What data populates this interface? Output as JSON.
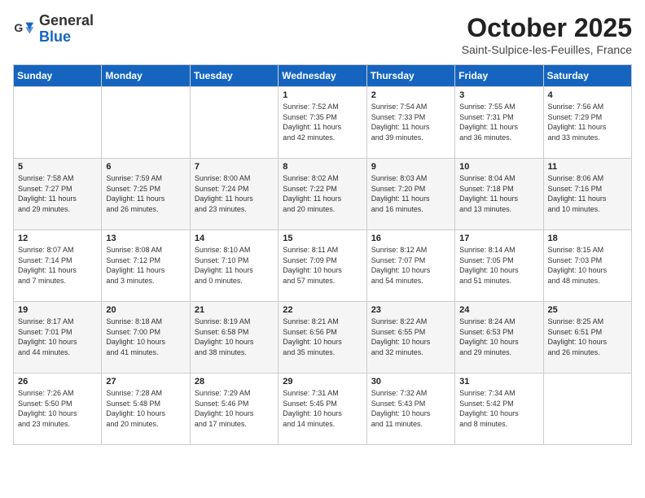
{
  "header": {
    "logo_general": "General",
    "logo_blue": "Blue",
    "month": "October 2025",
    "location": "Saint-Sulpice-les-Feuilles, France"
  },
  "days_of_week": [
    "Sunday",
    "Monday",
    "Tuesday",
    "Wednesday",
    "Thursday",
    "Friday",
    "Saturday"
  ],
  "weeks": [
    [
      {
        "day": "",
        "info": ""
      },
      {
        "day": "",
        "info": ""
      },
      {
        "day": "",
        "info": ""
      },
      {
        "day": "1",
        "info": "Sunrise: 7:52 AM\nSunset: 7:35 PM\nDaylight: 11 hours\nand 42 minutes."
      },
      {
        "day": "2",
        "info": "Sunrise: 7:54 AM\nSunset: 7:33 PM\nDaylight: 11 hours\nand 39 minutes."
      },
      {
        "day": "3",
        "info": "Sunrise: 7:55 AM\nSunset: 7:31 PM\nDaylight: 11 hours\nand 36 minutes."
      },
      {
        "day": "4",
        "info": "Sunrise: 7:56 AM\nSunset: 7:29 PM\nDaylight: 11 hours\nand 33 minutes."
      }
    ],
    [
      {
        "day": "5",
        "info": "Sunrise: 7:58 AM\nSunset: 7:27 PM\nDaylight: 11 hours\nand 29 minutes."
      },
      {
        "day": "6",
        "info": "Sunrise: 7:59 AM\nSunset: 7:25 PM\nDaylight: 11 hours\nand 26 minutes."
      },
      {
        "day": "7",
        "info": "Sunrise: 8:00 AM\nSunset: 7:24 PM\nDaylight: 11 hours\nand 23 minutes."
      },
      {
        "day": "8",
        "info": "Sunrise: 8:02 AM\nSunset: 7:22 PM\nDaylight: 11 hours\nand 20 minutes."
      },
      {
        "day": "9",
        "info": "Sunrise: 8:03 AM\nSunset: 7:20 PM\nDaylight: 11 hours\nand 16 minutes."
      },
      {
        "day": "10",
        "info": "Sunrise: 8:04 AM\nSunset: 7:18 PM\nDaylight: 11 hours\nand 13 minutes."
      },
      {
        "day": "11",
        "info": "Sunrise: 8:06 AM\nSunset: 7:16 PM\nDaylight: 11 hours\nand 10 minutes."
      }
    ],
    [
      {
        "day": "12",
        "info": "Sunrise: 8:07 AM\nSunset: 7:14 PM\nDaylight: 11 hours\nand 7 minutes."
      },
      {
        "day": "13",
        "info": "Sunrise: 8:08 AM\nSunset: 7:12 PM\nDaylight: 11 hours\nand 3 minutes."
      },
      {
        "day": "14",
        "info": "Sunrise: 8:10 AM\nSunset: 7:10 PM\nDaylight: 11 hours\nand 0 minutes."
      },
      {
        "day": "15",
        "info": "Sunrise: 8:11 AM\nSunset: 7:09 PM\nDaylight: 10 hours\nand 57 minutes."
      },
      {
        "day": "16",
        "info": "Sunrise: 8:12 AM\nSunset: 7:07 PM\nDaylight: 10 hours\nand 54 minutes."
      },
      {
        "day": "17",
        "info": "Sunrise: 8:14 AM\nSunset: 7:05 PM\nDaylight: 10 hours\nand 51 minutes."
      },
      {
        "day": "18",
        "info": "Sunrise: 8:15 AM\nSunset: 7:03 PM\nDaylight: 10 hours\nand 48 minutes."
      }
    ],
    [
      {
        "day": "19",
        "info": "Sunrise: 8:17 AM\nSunset: 7:01 PM\nDaylight: 10 hours\nand 44 minutes."
      },
      {
        "day": "20",
        "info": "Sunrise: 8:18 AM\nSunset: 7:00 PM\nDaylight: 10 hours\nand 41 minutes."
      },
      {
        "day": "21",
        "info": "Sunrise: 8:19 AM\nSunset: 6:58 PM\nDaylight: 10 hours\nand 38 minutes."
      },
      {
        "day": "22",
        "info": "Sunrise: 8:21 AM\nSunset: 6:56 PM\nDaylight: 10 hours\nand 35 minutes."
      },
      {
        "day": "23",
        "info": "Sunrise: 8:22 AM\nSunset: 6:55 PM\nDaylight: 10 hours\nand 32 minutes."
      },
      {
        "day": "24",
        "info": "Sunrise: 8:24 AM\nSunset: 6:53 PM\nDaylight: 10 hours\nand 29 minutes."
      },
      {
        "day": "25",
        "info": "Sunrise: 8:25 AM\nSunset: 6:51 PM\nDaylight: 10 hours\nand 26 minutes."
      }
    ],
    [
      {
        "day": "26",
        "info": "Sunrise: 7:26 AM\nSunset: 5:50 PM\nDaylight: 10 hours\nand 23 minutes."
      },
      {
        "day": "27",
        "info": "Sunrise: 7:28 AM\nSunset: 5:48 PM\nDaylight: 10 hours\nand 20 minutes."
      },
      {
        "day": "28",
        "info": "Sunrise: 7:29 AM\nSunset: 5:46 PM\nDaylight: 10 hours\nand 17 minutes."
      },
      {
        "day": "29",
        "info": "Sunrise: 7:31 AM\nSunset: 5:45 PM\nDaylight: 10 hours\nand 14 minutes."
      },
      {
        "day": "30",
        "info": "Sunrise: 7:32 AM\nSunset: 5:43 PM\nDaylight: 10 hours\nand 11 minutes."
      },
      {
        "day": "31",
        "info": "Sunrise: 7:34 AM\nSunset: 5:42 PM\nDaylight: 10 hours\nand 8 minutes."
      },
      {
        "day": "",
        "info": ""
      }
    ]
  ]
}
